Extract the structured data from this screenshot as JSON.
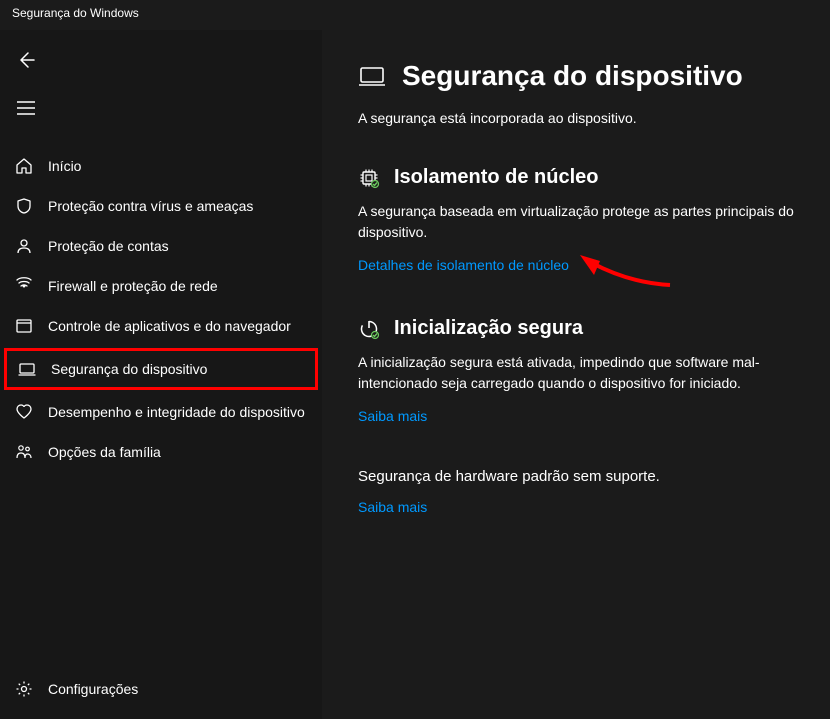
{
  "window": {
    "title": "Segurança do Windows"
  },
  "sidebar": {
    "items": [
      {
        "label": "Início"
      },
      {
        "label": "Proteção contra vírus e ameaças"
      },
      {
        "label": "Proteção de contas"
      },
      {
        "label": "Firewall e proteção de rede"
      },
      {
        "label": "Controle de aplicativos e do navegador"
      },
      {
        "label": "Segurança do dispositivo"
      },
      {
        "label": "Desempenho e integridade do dispositivo"
      },
      {
        "label": "Opções da família"
      }
    ],
    "settings_label": "Configurações"
  },
  "page": {
    "title": "Segurança do dispositivo",
    "subtitle": "A segurança está incorporada ao dispositivo."
  },
  "core_isolation": {
    "title": "Isolamento de núcleo",
    "desc": "A segurança baseada em virtualização protege as partes principais do dispositivo.",
    "link": "Detalhes de isolamento de núcleo"
  },
  "secure_boot": {
    "title": "Inicialização segura",
    "desc": "A inicialização segura está ativada, impedindo que software mal-intencionado seja carregado quando o dispositivo for iniciado.",
    "link": "Saiba mais"
  },
  "hardware": {
    "text": "Segurança de hardware padrão sem suporte.",
    "link": "Saiba mais"
  }
}
